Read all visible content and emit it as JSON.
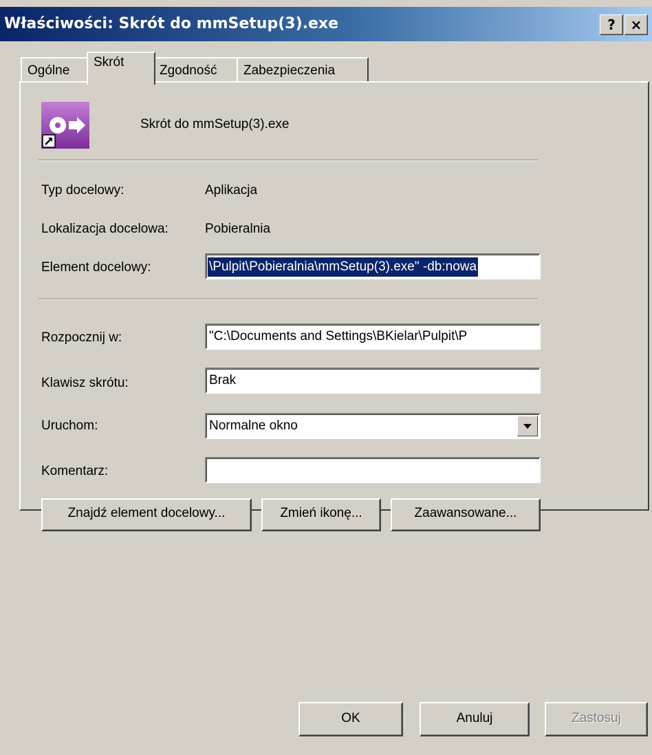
{
  "window": {
    "title": "Właściwości: Skrót do mmSetup(3).exe",
    "help_label": "?",
    "close_label": "×"
  },
  "tabs": [
    {
      "label": "Ogólne"
    },
    {
      "label": "Skrót"
    },
    {
      "label": "Zgodność"
    },
    {
      "label": "Zabezpieczenia"
    }
  ],
  "shortcut": {
    "name": "Skrót do mmSetup(3).exe",
    "icon": "setup-shortcut-icon"
  },
  "fields": {
    "target_type_label": "Typ docelowy:",
    "target_type_value": "Aplikacja",
    "target_location_label": "Lokalizacja docelowa:",
    "target_location_value": "Pobieralnia",
    "target_label": "Element docelowy:",
    "target_value": "\\Pulpit\\Pobieralnia\\mmSetup(3).exe\" -db:nowa",
    "start_in_label": "Rozpocznij w:",
    "start_in_value": "\"C:\\Documents and Settings\\BKielar\\Pulpit\\P",
    "hotkey_label": "Klawisz skrótu:",
    "hotkey_value": "Brak",
    "run_label": "Uruchom:",
    "run_value": "Normalne okno",
    "comment_label": "Komentarz:",
    "comment_value": ""
  },
  "buttons": {
    "find_target": "Znajdź element docelowy...",
    "change_icon": "Zmień ikonę...",
    "advanced": "Zaawansowane...",
    "ok": "OK",
    "cancel": "Anuluj",
    "apply": "Zastosuj"
  },
  "colors": {
    "titlebar_start": "#0a246a",
    "titlebar_end": "#a6caf0",
    "face": "#d4d0c8",
    "selection": "#0a246a"
  }
}
